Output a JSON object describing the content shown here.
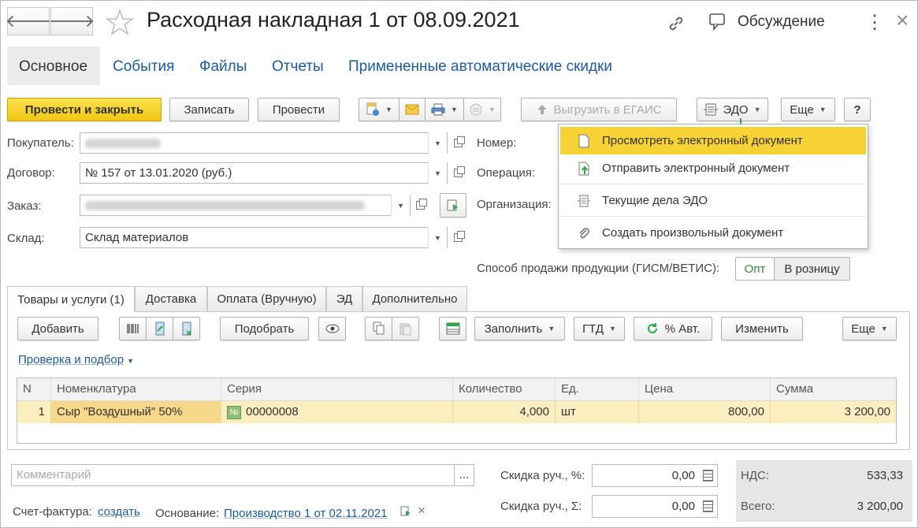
{
  "header": {
    "back": "🡐",
    "forward": "🡒",
    "title": "Расходная накладная 1 от 08.09.2021",
    "discussion": "Обсуждение",
    "more": "⋮",
    "close": "×"
  },
  "tabs": [
    "Основное",
    "События",
    "Файлы",
    "Отчеты",
    "Примененные автоматические скидки"
  ],
  "toolbar": {
    "post_close": "Провести и закрыть",
    "save": "Записать",
    "post": "Провести",
    "egais": "Выгрузить в ЕГАИС",
    "edo": "ЭДО",
    "more": "Еще",
    "help": "?"
  },
  "fields": {
    "buyer_label": "Покупатель:",
    "contract_label": "Договор:",
    "contract_value": "№ 157 от 13.01.2020 (руб.)",
    "order_label": "Заказ:",
    "warehouse_label": "Склад:",
    "warehouse_value": "Склад материалов",
    "number_label": "Номер:",
    "operation_label": "Операция:",
    "org_label": "Организация:",
    "sale_method_label": "Способ продажи продукции (ГИСМ/ВЕТИС):",
    "sale_opt": "Опт",
    "sale_retail": "В розницу"
  },
  "edo_menu": [
    {
      "label": "Просмотреть электронный документ",
      "icon": "document-icon",
      "selected": true
    },
    {
      "label": "Отправить электронный документ",
      "icon": "send-document-icon",
      "selected": false
    },
    {
      "label": "Текущие дела ЭДО",
      "icon": "edo-tasks-icon",
      "selected": false
    },
    {
      "label": "Создать произвольный документ",
      "icon": "paperclip-icon",
      "selected": false
    }
  ],
  "doc_tabs": [
    "Товары и услуги (1)",
    "Доставка",
    "Оплата (Вручную)",
    "ЭД",
    "Дополнительно"
  ],
  "table_toolbar": {
    "add": "Добавить",
    "pick": "Подобрать",
    "fill": "Заполнить",
    "gtd": "ГТД",
    "auto_pct": "% Авт.",
    "change": "Изменить",
    "more": "Еще",
    "check_link": "Проверка и подбор"
  },
  "table": {
    "headers": [
      "N",
      "Номенклатура",
      "Серия",
      "Количество",
      "Ед.",
      "Цена",
      "Сумма"
    ],
    "rows": [
      {
        "n": "1",
        "item": "Сыр \"Воздушный\" 50%",
        "series": "00000008",
        "qty": "4,000",
        "unit": "шт",
        "price": "800,00",
        "sum": "3 200,00"
      }
    ]
  },
  "footer": {
    "comment_placeholder": "Комментарий",
    "comment_btn": "...",
    "discount_pct_label": "Скидка руч., %:",
    "discount_pct": "0,00",
    "discount_sum_label": "Скидка руч., Σ:",
    "discount_sum": "0,00",
    "vat_label": "НДС:",
    "vat": "533,33",
    "total_label": "Всего:",
    "total": "3 200,00",
    "invoice_label": "Счет-фактура:",
    "invoice_link": "создать",
    "basis_label": "Основание:",
    "basis_link": "Производство 1 от 02.11.2021",
    "basis_clear": "×"
  },
  "colors": {
    "accent_yellow": "#f7d234",
    "link": "#1c5aa3",
    "row_highlight": "#fbefc0",
    "totals_bg": "#e6e6e6"
  }
}
